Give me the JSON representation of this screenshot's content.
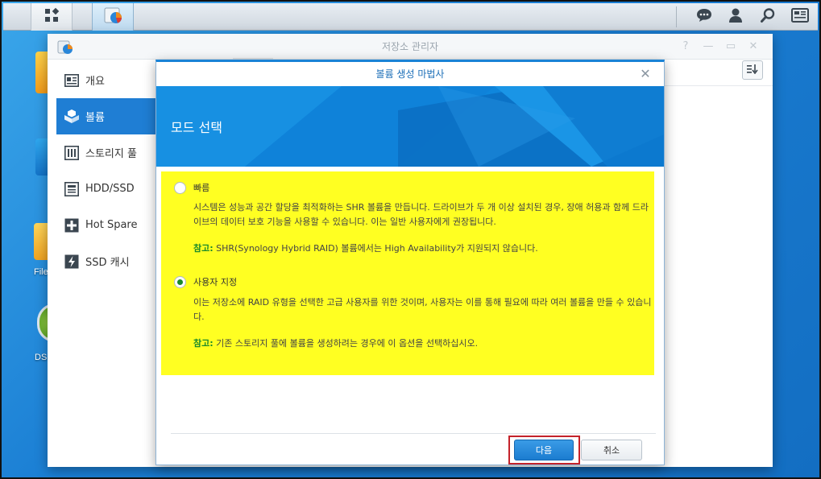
{
  "taskbar": {
    "main_menu_icon": "grid-icon",
    "active_app_icon": "storage-manager-icon",
    "right_icons": [
      "chat-icon",
      "user-icon",
      "search-icon",
      "widgets-icon"
    ]
  },
  "desktop": {
    "labels": [
      "File",
      "DS"
    ]
  },
  "window": {
    "title": "저장소 관리자",
    "sidebar": [
      {
        "label": "개요",
        "icon": "overview-icon"
      },
      {
        "label": "볼륨",
        "icon": "volume-icon",
        "active": true
      },
      {
        "label": "스토리지 풀",
        "icon": "storage-pool-icon"
      },
      {
        "label": "HDD/SSD",
        "icon": "hdd-icon"
      },
      {
        "label": "Hot Spare",
        "icon": "hot-spare-icon"
      },
      {
        "label": "SSD 캐시",
        "icon": "ssd-cache-icon"
      }
    ]
  },
  "dialog": {
    "title": "볼륨 생성 마법사",
    "banner_title": "모드 선택",
    "options": [
      {
        "label": "빠름",
        "selected": false,
        "desc": "시스템은 성능과 공간 할당을 최적화하는 SHR 볼륨을 만듭니다. 드라이브가 두 개 이상 설치된 경우, 장애 허용과 함께 드라이브의 데이터 보호 기능을 사용할 수 있습니다. 이는 일반 사용자에게 권장됩니다.",
        "note_key": "참고:",
        "note_text": " SHR(Synology Hybrid RAID) 볼륨에서는 High Availability가 지원되지 않습니다."
      },
      {
        "label": "사용자 지정",
        "selected": true,
        "desc": "이는 저장소에 RAID 유형을 선택한 고급 사용자를 위한 것이며, 사용자는 이를 통해 필요에 따라 여러 볼륨을 만들 수 있습니다.",
        "note_key": "참고:",
        "note_text": " 기존 스토리지 풀에 볼륨을 생성하려는 경우에 이 옵션을 선택하십시오."
      }
    ],
    "next_label": "다음",
    "cancel_label": "취소"
  },
  "colors": {
    "accent": "#1a83d6",
    "highlight": "#ffff22",
    "note": "#1a8a2a",
    "outline": "#c4222a"
  }
}
